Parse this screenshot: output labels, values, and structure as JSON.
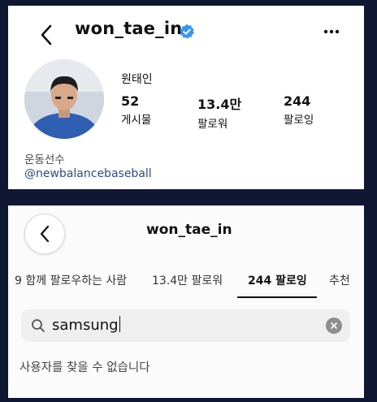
{
  "profile": {
    "username": "won_tae_in",
    "display_name": "원태인",
    "stats": {
      "posts": {
        "value": "52",
        "label": "게시물"
      },
      "followers": {
        "value": "13.4만",
        "label": "팔로워"
      },
      "following": {
        "value": "244",
        "label": "팔로잉"
      }
    },
    "bio_category": "운동선수",
    "bio_link": "@newbalancebaseball",
    "icons": {
      "back": "chevron-left-icon",
      "verified": "verified-badge-icon",
      "more": "more-horizontal-icon"
    },
    "colors": {
      "verified": "#3897f0",
      "link": "#2f4a8a"
    }
  },
  "following_screen": {
    "username": "won_tae_in",
    "tabs": [
      {
        "label": "9 함께 팔로우하는 사람"
      },
      {
        "label": "13.4만 팔로워"
      },
      {
        "label": "244 팔로잉",
        "active": true
      },
      {
        "label": "추천"
      }
    ],
    "search": {
      "value": "samsung"
    },
    "empty_message": "사용자를 찾을 수 없습니다"
  }
}
